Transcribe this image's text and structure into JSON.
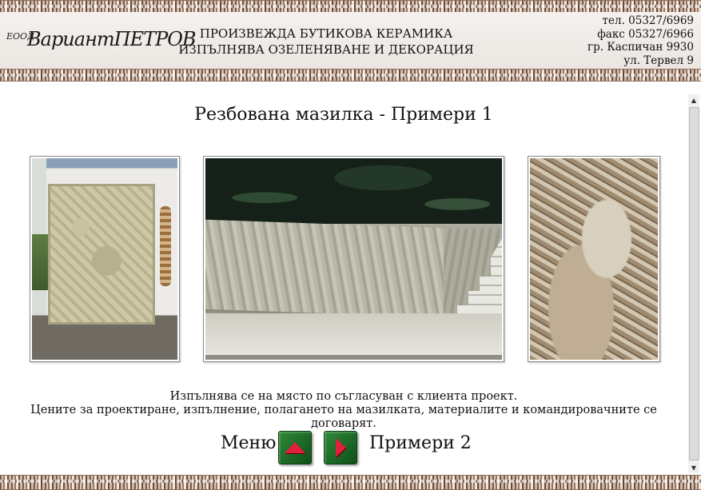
{
  "header": {
    "logo_small": "ЕООД",
    "logo_big": "ВариантПЕТРОВ",
    "tagline_line1": "ПРОИЗВЕЖДА БУТИКОВА КЕРАМИКА",
    "tagline_line2": "ИЗПЪЛНЯВА ОЗЕЛЕНЯВАНЕ И ДЕКОРАЦИЯ",
    "contacts": {
      "phone": "тел. 05327/6969",
      "fax": "факс 05327/6966",
      "city": "гр. Каспичан 9930",
      "street": "ул. Тервел 9"
    }
  },
  "main": {
    "title": "Резбована мазилка - Примери 1",
    "photos": [
      "carved-relief-wall",
      "carved-relief-block",
      "carved-relief-panel"
    ],
    "description_line1": "Изпълнява се на място по съгласуван с клиента проект.",
    "description_line2": "Цените за проектиране, изпълнение, полагането на мазилката, материалите и командировачните се договарят."
  },
  "nav": {
    "menu_label": "Меню",
    "next_label": "Примери 2",
    "up_icon": "arrow-up-icon",
    "next_icon": "arrow-right-icon"
  },
  "colors": {
    "button_green": "#1f6b2a",
    "arrow_red": "#e0203c",
    "ornament_brown": "#7a5a48"
  }
}
